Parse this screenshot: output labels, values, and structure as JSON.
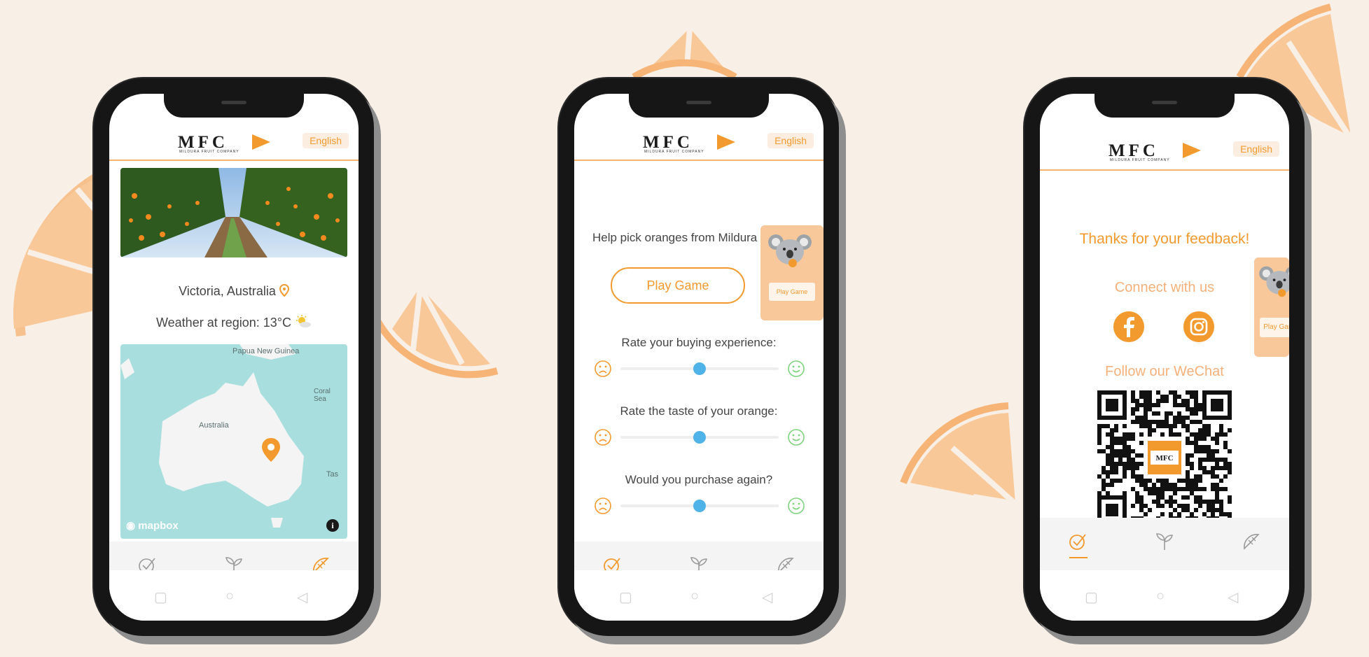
{
  "app": {
    "logo_text": "MFC",
    "logo_subtitle": "MILDURA FRUIT COMPANY",
    "language": "English"
  },
  "screen_location": {
    "location": "Victoria, Australia",
    "weather": "Weather at region: 13°C",
    "map": {
      "labels": [
        "Papua New Guinea",
        "Coral Sea",
        "Australia",
        "Tas"
      ],
      "attribution": "mapbox",
      "info": "i"
    }
  },
  "screen_feedback": {
    "help_text": "Help pick oranges from Mildura",
    "play_button": "Play Game",
    "mini_play_button": "Play Game",
    "questions": [
      {
        "label": "Rate your buying experience:",
        "value": 0.5
      },
      {
        "label": "Rate the taste of your orange:",
        "value": 0.5
      },
      {
        "label": "Would you purchase again?",
        "value": 0.5
      }
    ]
  },
  "screen_thanks": {
    "thanks": "Thanks for your feedback!",
    "connect": "Connect with us",
    "follow": "Follow our WeChat",
    "qr_center": "MFC",
    "mini_play_button": "Play Game"
  },
  "tabs": [
    "check-circle-icon",
    "sprout-icon",
    "orange-slice-icon"
  ],
  "nav_buttons": [
    "recent-apps-icon",
    "home-icon",
    "back-icon"
  ],
  "colors": {
    "accent": "#f39a2e",
    "accent_light": "#f5b07a",
    "background": "#f8efe6",
    "slider_thumb": "#4fb3e8",
    "sad_face": "#f39a2e",
    "happy_face": "#7ed37e"
  }
}
